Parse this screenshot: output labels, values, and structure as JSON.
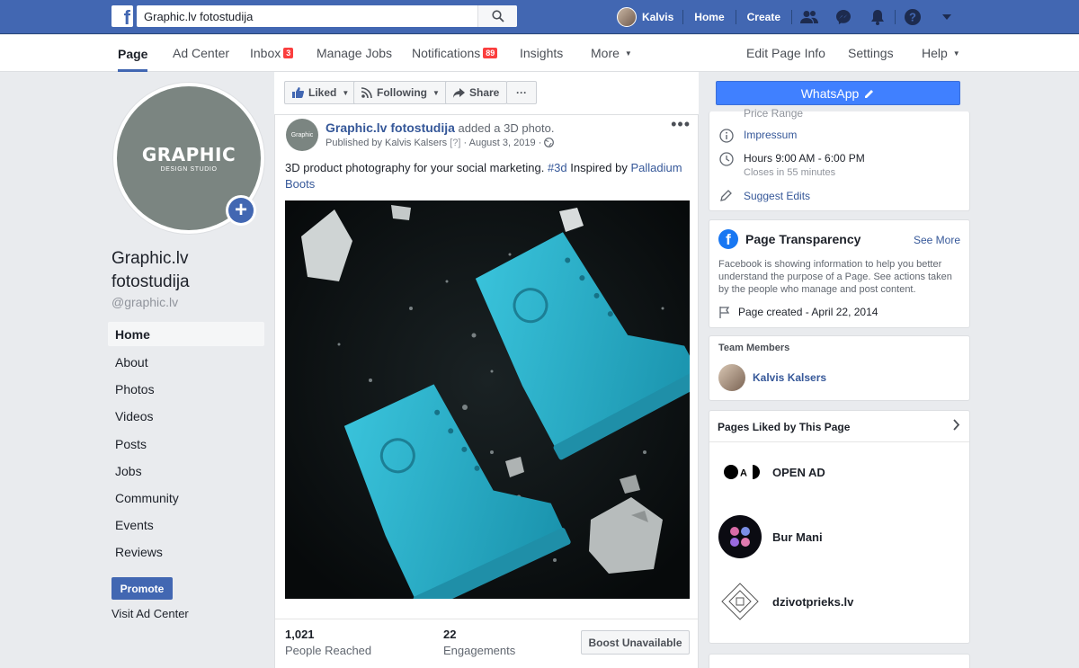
{
  "topbar": {
    "search_value": "Graphic.lv fotostudija",
    "user_name": "Kalvis",
    "home_label": "Home",
    "create_label": "Create"
  },
  "pagebar": {
    "items": [
      "Page",
      "Ad Center",
      "Inbox",
      "Manage Jobs",
      "Notifications",
      "Insights",
      "More"
    ],
    "inbox_badge": "3",
    "notifications_badge": "89",
    "right_items": [
      "Edit Page Info",
      "Settings",
      "Help"
    ]
  },
  "profile": {
    "logo_big": "GRAPHIC",
    "logo_small": "DESIGN STUDIO",
    "name_line1": "Graphic.lv",
    "name_line2": "fotostudija",
    "handle": "@graphic.lv"
  },
  "left_nav": [
    "Home",
    "About",
    "Photos",
    "Videos",
    "Posts",
    "Jobs",
    "Community",
    "Events",
    "Reviews"
  ],
  "promote_label": "Promote",
  "visit_ad_center": "Visit Ad Center",
  "action_bar": {
    "liked": "Liked",
    "following": "Following",
    "share": "Share",
    "more": "···"
  },
  "post": {
    "page_name": "Graphic.lv fotostudija",
    "action": " added a 3D photo.",
    "published_by": "Published by Kalvis Kalsers",
    "help_mark": "[?]",
    "date": "August 3, 2019",
    "text_main": "3D product photography for your social marketing. ",
    "hashtag": "#3d",
    "text_inspired": " Inspired by ",
    "link": "Palladium Boots",
    "reached_num": "1,021",
    "reached_label": "People Reached",
    "engagements_num": "22",
    "engagements_label": "Engagements",
    "boost_label": "Boost Unavailable",
    "avatar_text": "Graphic"
  },
  "right": {
    "whatsapp_label": "WhatsApp",
    "price_range_partial": "Price Range",
    "impressum": "Impressum",
    "hours": "Hours 9:00 AM - 6:00 PM",
    "closes": "Closes in 55 minutes",
    "suggest_edits": "Suggest Edits",
    "transparency_title": "Page Transparency",
    "see_more": "See More",
    "transparency_text": "Facebook is showing information to help you better understand the purpose of a Page. See actions taken by the people who manage and post content.",
    "page_created": "Page created - April 22, 2014",
    "team_members_title": "Team Members",
    "team_member": "Kalvis Kalsers",
    "pages_liked_title": "Pages Liked by This Page",
    "liked_pages": [
      "OPEN AD",
      "Bur Mani",
      "dzivotprieks.lv"
    ],
    "openad_logo_letter": "A"
  },
  "colors": {
    "fb_blue": "#4267b2",
    "whatsapp_blue": "#4080ff",
    "badge_red": "#fa3e3e",
    "boot_teal": "#2bb3cc"
  }
}
